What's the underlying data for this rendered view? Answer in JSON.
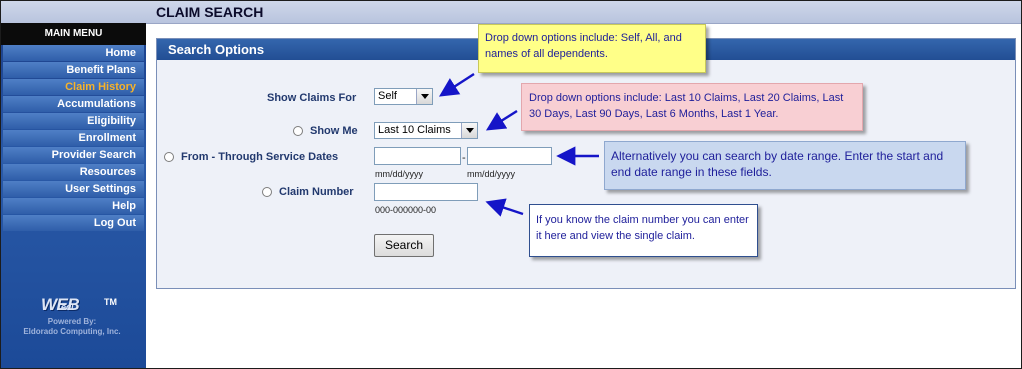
{
  "page": {
    "title": "CLAIM SEARCH"
  },
  "sidebar": {
    "header": "MAIN MENU",
    "items": [
      {
        "label": "Home"
      },
      {
        "label": "Benefit Plans"
      },
      {
        "label": "Claim History"
      },
      {
        "label": "Accumulations"
      },
      {
        "label": "Eligibility"
      },
      {
        "label": "Enrollment"
      },
      {
        "label": "Provider Search"
      },
      {
        "label": "Resources"
      },
      {
        "label": "User Settings"
      },
      {
        "label": "Help"
      },
      {
        "label": "Log Out"
      }
    ],
    "active_item": "Claim History",
    "logo": {
      "word": "WEB",
      "sub": "ecl",
      "tm": "TM",
      "powered_by": "Powered By:",
      "company": "Eldorado Computing, Inc."
    }
  },
  "search": {
    "header": "Search Options",
    "show_claims_for": {
      "label": "Show Claims For",
      "value": "Self"
    },
    "show_me": {
      "label": "Show Me",
      "value": "Last 10 Claims"
    },
    "date_range": {
      "label": "From - Through Service Dates",
      "separator": "-",
      "from_hint": "mm/dd/yyyy",
      "to_hint": "mm/dd/yyyy"
    },
    "claim_number": {
      "label": "Claim Number",
      "hint": "000-000000-00"
    },
    "button": "Search"
  },
  "callouts": {
    "dropdown_for": "Drop down options include: Self, All, and names of all dependents.",
    "dropdown_show": "Drop down options include: Last 10 Claims, Last 20 Claims, Last 30 Days, Last 90 Days, Last 6 Months, Last 1 Year.",
    "date_range": "Alternatively you can search by date range.  Enter the start and end date range in these fields.",
    "claim_number": "If you know the claim number you can enter it here and view the single claim."
  },
  "colors": {
    "accent": "#f7b32a",
    "sidebar": "#2a5aa8",
    "panel_header": "#2b5aa0",
    "callout_text": "#1e1e9a",
    "arrow": "#1515c8"
  }
}
